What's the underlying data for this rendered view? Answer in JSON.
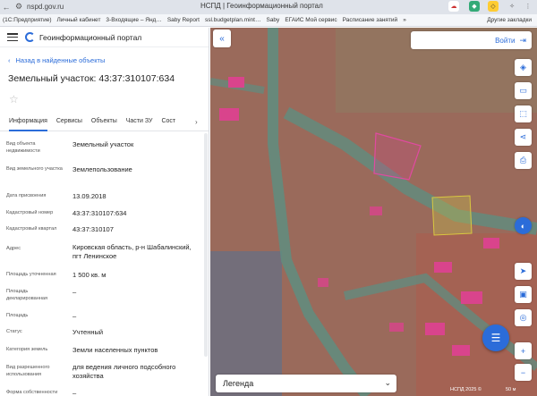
{
  "browser": {
    "url": "nspd.gov.ru",
    "window_title": "НСПД | Геоинформационный портал",
    "bookmarks": [
      "(1С:Предприятие)",
      "Личный кабинет",
      "3-Входящие – Янд…",
      "Saby Report",
      "ssl.budgetplan.mint…",
      "Saby",
      "ЕГАИС Мой сервис",
      "Расписание занятий"
    ],
    "more_bookmarks": "»",
    "other_bookmarks": "Другие закладки"
  },
  "panel": {
    "portal_title": "Геоинформационный портал",
    "back_label": "Назад в найденные объекты",
    "object_title": "Земельный участок: 43:37:310107:634",
    "tabs": [
      {
        "label": "Информация",
        "active": true
      },
      {
        "label": "Сервисы"
      },
      {
        "label": "Объекты"
      },
      {
        "label": "Части ЗУ"
      },
      {
        "label": "Сост"
      }
    ],
    "fields": [
      {
        "label": "Вид объекта недвижимости",
        "value": "Земельный участок"
      },
      {
        "label": "Вид земельного участка",
        "value": "Землепользование"
      },
      {
        "label": "Дата присвоения",
        "value": "13.09.2018"
      },
      {
        "label": "Кадастровый номер",
        "value": "43:37:310107:634"
      },
      {
        "label": "Кадастровый квартал",
        "value": "43:37:310107"
      },
      {
        "label": "Адрес",
        "value": "Кировская область, р-н Шабалинский, пгт Ленинское"
      },
      {
        "label": "Площадь уточненная",
        "value": "1 500 кв. м"
      },
      {
        "label": "Площадь декларированная",
        "value": "–"
      },
      {
        "label": "Площадь",
        "value": "–"
      },
      {
        "label": "Статус",
        "value": "Учтенный"
      },
      {
        "label": "Категория земель",
        "value": "Земли населенных пунктов"
      },
      {
        "label": "Вид разрешенного использования",
        "value": "для ведения личного подсобного хозяйства"
      },
      {
        "label": "Форма собственности",
        "value": "–"
      }
    ]
  },
  "map": {
    "login_label": "Войти",
    "legend_label": "Легенда",
    "copyright": "НСПД 2025 ©",
    "scale_label": "50 м",
    "parcel_color": "#d9448c",
    "road_color": "#5a8a7c",
    "accent_color": "#2b6cd9"
  }
}
